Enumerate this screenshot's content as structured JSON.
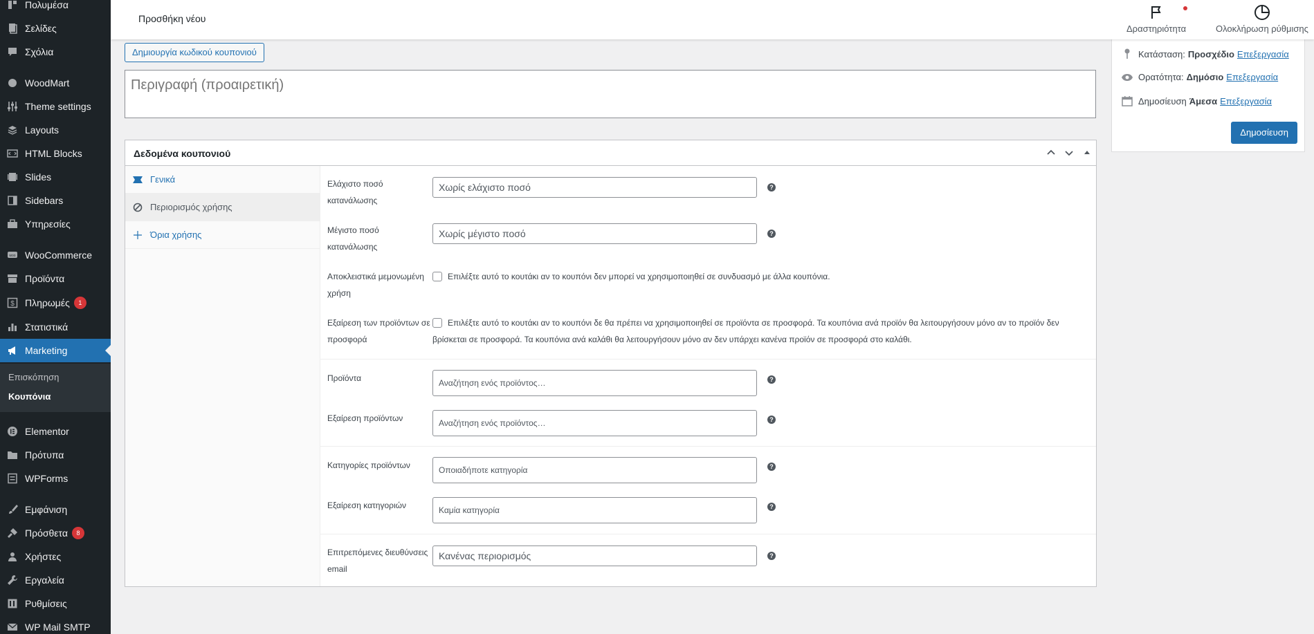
{
  "sidebar": {
    "items": [
      {
        "label": "Πολυμέσα",
        "icon": "media-icon"
      },
      {
        "label": "Σελίδες",
        "icon": "pages-icon"
      },
      {
        "label": "Σχόλια",
        "icon": "comments-icon"
      },
      {
        "label": "WoodMart",
        "icon": "woodmart-icon"
      },
      {
        "label": "Theme settings",
        "icon": "sliders-icon"
      },
      {
        "label": "Layouts",
        "icon": "layers-icon"
      },
      {
        "label": "HTML Blocks",
        "icon": "html-icon"
      },
      {
        "label": "Slides",
        "icon": "slides-icon"
      },
      {
        "label": "Sidebars",
        "icon": "sidebar-icon"
      },
      {
        "label": "Υπηρεσίες",
        "icon": "briefcase-icon"
      },
      {
        "label": "WooCommerce",
        "icon": "woo-icon"
      },
      {
        "label": "Προϊόντα",
        "icon": "archive-icon"
      },
      {
        "label": "Πληρωμές",
        "icon": "payments-icon",
        "badge": "1"
      },
      {
        "label": "Στατιστικά",
        "icon": "chart-bar-icon"
      },
      {
        "label": "Marketing",
        "icon": "megaphone-icon"
      },
      {
        "label": "Elementor",
        "icon": "elementor-icon"
      },
      {
        "label": "Πρότυπα",
        "icon": "folder-icon"
      },
      {
        "label": "WPForms",
        "icon": "forms-icon"
      },
      {
        "label": "Εμφάνιση",
        "icon": "brush-icon"
      },
      {
        "label": "Πρόσθετα",
        "icon": "plugin-icon",
        "badge": "8"
      },
      {
        "label": "Χρήστες",
        "icon": "users-icon"
      },
      {
        "label": "Εργαλεία",
        "icon": "wrench-icon"
      },
      {
        "label": "Ρυθμίσεις",
        "icon": "settings-icon"
      },
      {
        "label": "WP Mail SMTP",
        "icon": "mail-icon"
      }
    ],
    "submenu": {
      "overview": "Επισκόπηση",
      "coupons": "Κουπόνια"
    }
  },
  "header": {
    "title": "Προσθήκη νέου",
    "activity": "Δραστηριότητα",
    "finish_setup": "Ολοκλήρωση ρύθμισης"
  },
  "main": {
    "create_code_button": "Δημιουργία κωδικού κουπονιού",
    "description_placeholder": "Περιγραφή (προαιρετική)"
  },
  "publish": {
    "status_label": "Κατάσταση:",
    "status_value": "Προσχέδιο",
    "visibility_label": "Ορατότητα:",
    "visibility_value": "Δημόσιο",
    "schedule_label": "Δημοσίευση",
    "schedule_value": "Άμεσα",
    "edit": "Επεξεργασία",
    "publish_button": "Δημοσίευση"
  },
  "coupon_data": {
    "title": "Δεδομένα κουπονιού",
    "tabs": [
      "Γενικά",
      "Περιορισμός χρήσης",
      "Όρια χρήσης"
    ],
    "fields": {
      "min_spend_label": "Ελάχιστο ποσό κατανάλωσης",
      "min_spend_placeholder": "Χωρίς ελάχιστο ποσό",
      "max_spend_label": "Μέγιστο ποσό κατανάλωσης",
      "max_spend_placeholder": "Χωρίς μέγιστο ποσό",
      "individual_use_label": "Αποκλειστικά μεμονωμένη χρήση",
      "individual_use_text": "Επιλέξτε αυτό το κουτάκι αν το κουπόνι δεν μπορεί να χρησιμοποιηθεί σε συνδυασμό με άλλα κουπόνια.",
      "exclude_sale_label": "Εξαίρεση των προϊόντων σε προσφορά",
      "exclude_sale_text": "Επιλέξτε αυτό το κουτάκι αν το κουπόνι δε θα πρέπει να χρησιμοποιηθεί σε προϊόντα σε προσφορά. Τα κουπόνια ανά προϊόν θα λειτουργήσουν μόνο αν το προϊόν δεν βρίσκεται σε προσφορά. Τα κουπόνια ανά καλάθι θα λειτουργήσουν μόνο αν δεν υπάρχει κανένα προϊόν σε προσφορά στο καλάθι.",
      "products_label": "Προϊόντα",
      "products_placeholder": "Αναζήτηση ενός προϊόντος…",
      "exclude_products_label": "Εξαίρεση προϊόντων",
      "exclude_products_placeholder": "Αναζήτηση ενός προϊόντος…",
      "categories_label": "Κατηγορίες προϊόντων",
      "categories_placeholder": "Οποιαδήποτε κατηγορία",
      "exclude_categories_label": "Εξαίρεση κατηγοριών",
      "exclude_categories_placeholder": "Καμία κατηγορία",
      "emails_label": "Επιτρεπόμενες διευθύνσεις email",
      "emails_placeholder": "Κανένας περιορισμός"
    }
  }
}
